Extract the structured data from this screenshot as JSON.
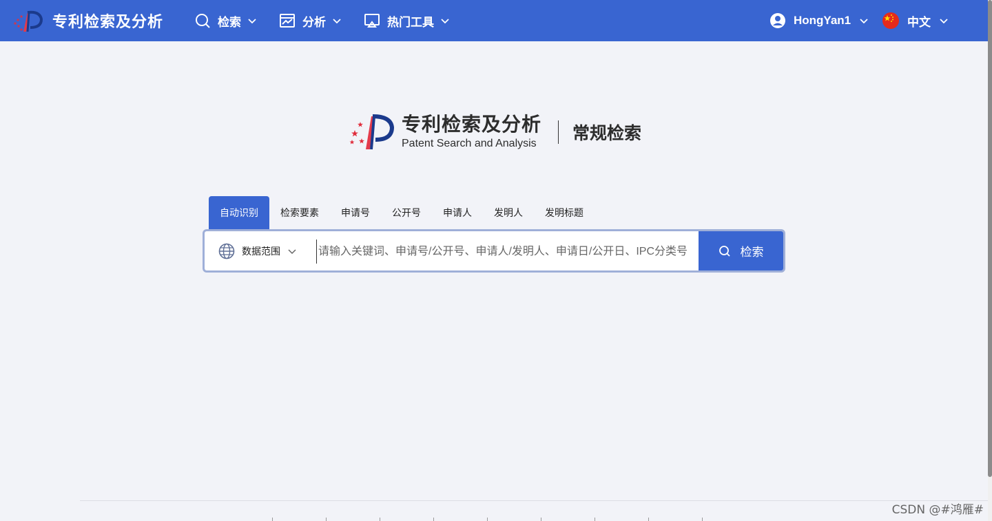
{
  "app": {
    "title": "专利检索及分析"
  },
  "nav": {
    "items": [
      {
        "label": "检索",
        "icon": "search-icon"
      },
      {
        "label": "分析",
        "icon": "chart-icon"
      },
      {
        "label": "热门工具",
        "icon": "monitor-icon"
      }
    ],
    "user": {
      "name": "HongYan1",
      "icon": "user-avatar-icon"
    },
    "language": {
      "label": "中文",
      "icon": "china-flag-icon"
    }
  },
  "hero": {
    "title_cn": "专利检索及分析",
    "title_en": "Patent Search and Analysis",
    "mode": "常规检索"
  },
  "search": {
    "tabs": [
      "自动识别",
      "检索要素",
      "申请号",
      "公开号",
      "申请人",
      "发明人",
      "发明标题"
    ],
    "active_tab": "自动识别",
    "scope_label": "数据范围",
    "placeholder": "请输入关键词、申请号/公开号、申请人/发明人、申请日/公开日、IPC分类号",
    "value": "",
    "button_label": "检索"
  },
  "watermark": "CSDN @#鸿雁#",
  "colors": {
    "primary": "#3965d1",
    "background": "#f2f3f8",
    "search_border": "#9fafd8"
  }
}
